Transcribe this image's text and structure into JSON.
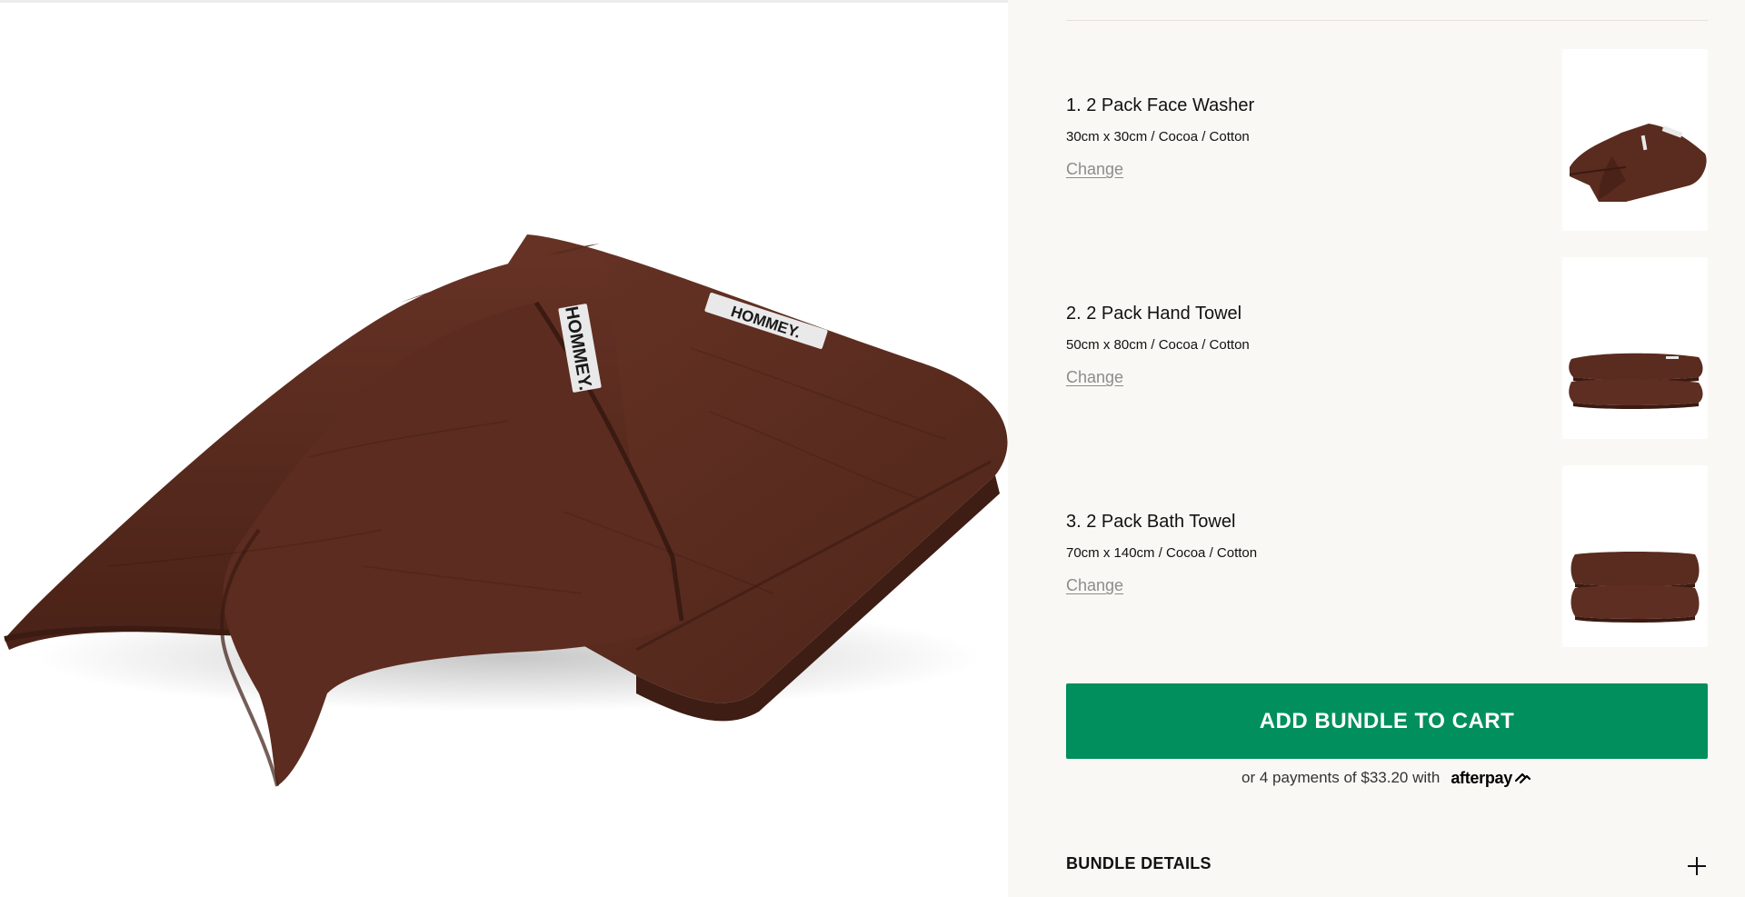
{
  "gallery": {
    "image_name": "folded-towel-product-photo",
    "label_front": "HOMMEY.",
    "label_top": "HOMMEY.",
    "colors": {
      "towel": "#5a2e22",
      "towel_dark": "#3e1d14",
      "towel_light": "#6e3a2c",
      "label": "#e9e9e9"
    }
  },
  "bundle": {
    "items": [
      {
        "title": "1. 2 Pack Face Washer",
        "variant": "30cm x 30cm / Cocoa / Cotton",
        "change_label": "Change",
        "thumb_icon": "face-washer-thumbnail"
      },
      {
        "title": "2. 2 Pack Hand Towel",
        "variant": "50cm x 80cm / Cocoa / Cotton",
        "change_label": "Change",
        "thumb_icon": "hand-towel-thumbnail"
      },
      {
        "title": "3. 2 Pack Bath Towel",
        "variant": "70cm x 140cm / Cocoa / Cotton",
        "change_label": "Change",
        "thumb_icon": "bath-towel-thumbnail"
      }
    ]
  },
  "cart": {
    "button_label": "ADD BUNDLE TO CART",
    "button_color": "#008f5d"
  },
  "afterpay": {
    "text": "or 4 payments of $33.20 with",
    "brand": "afterpay",
    "icon": "afterpay-arrows-icon"
  },
  "details": {
    "title": "BUNDLE DETAILS",
    "icon": "plus-icon"
  },
  "colors": {
    "panel_background": "#f9f8f4",
    "change_link": "#8c8c8c"
  }
}
